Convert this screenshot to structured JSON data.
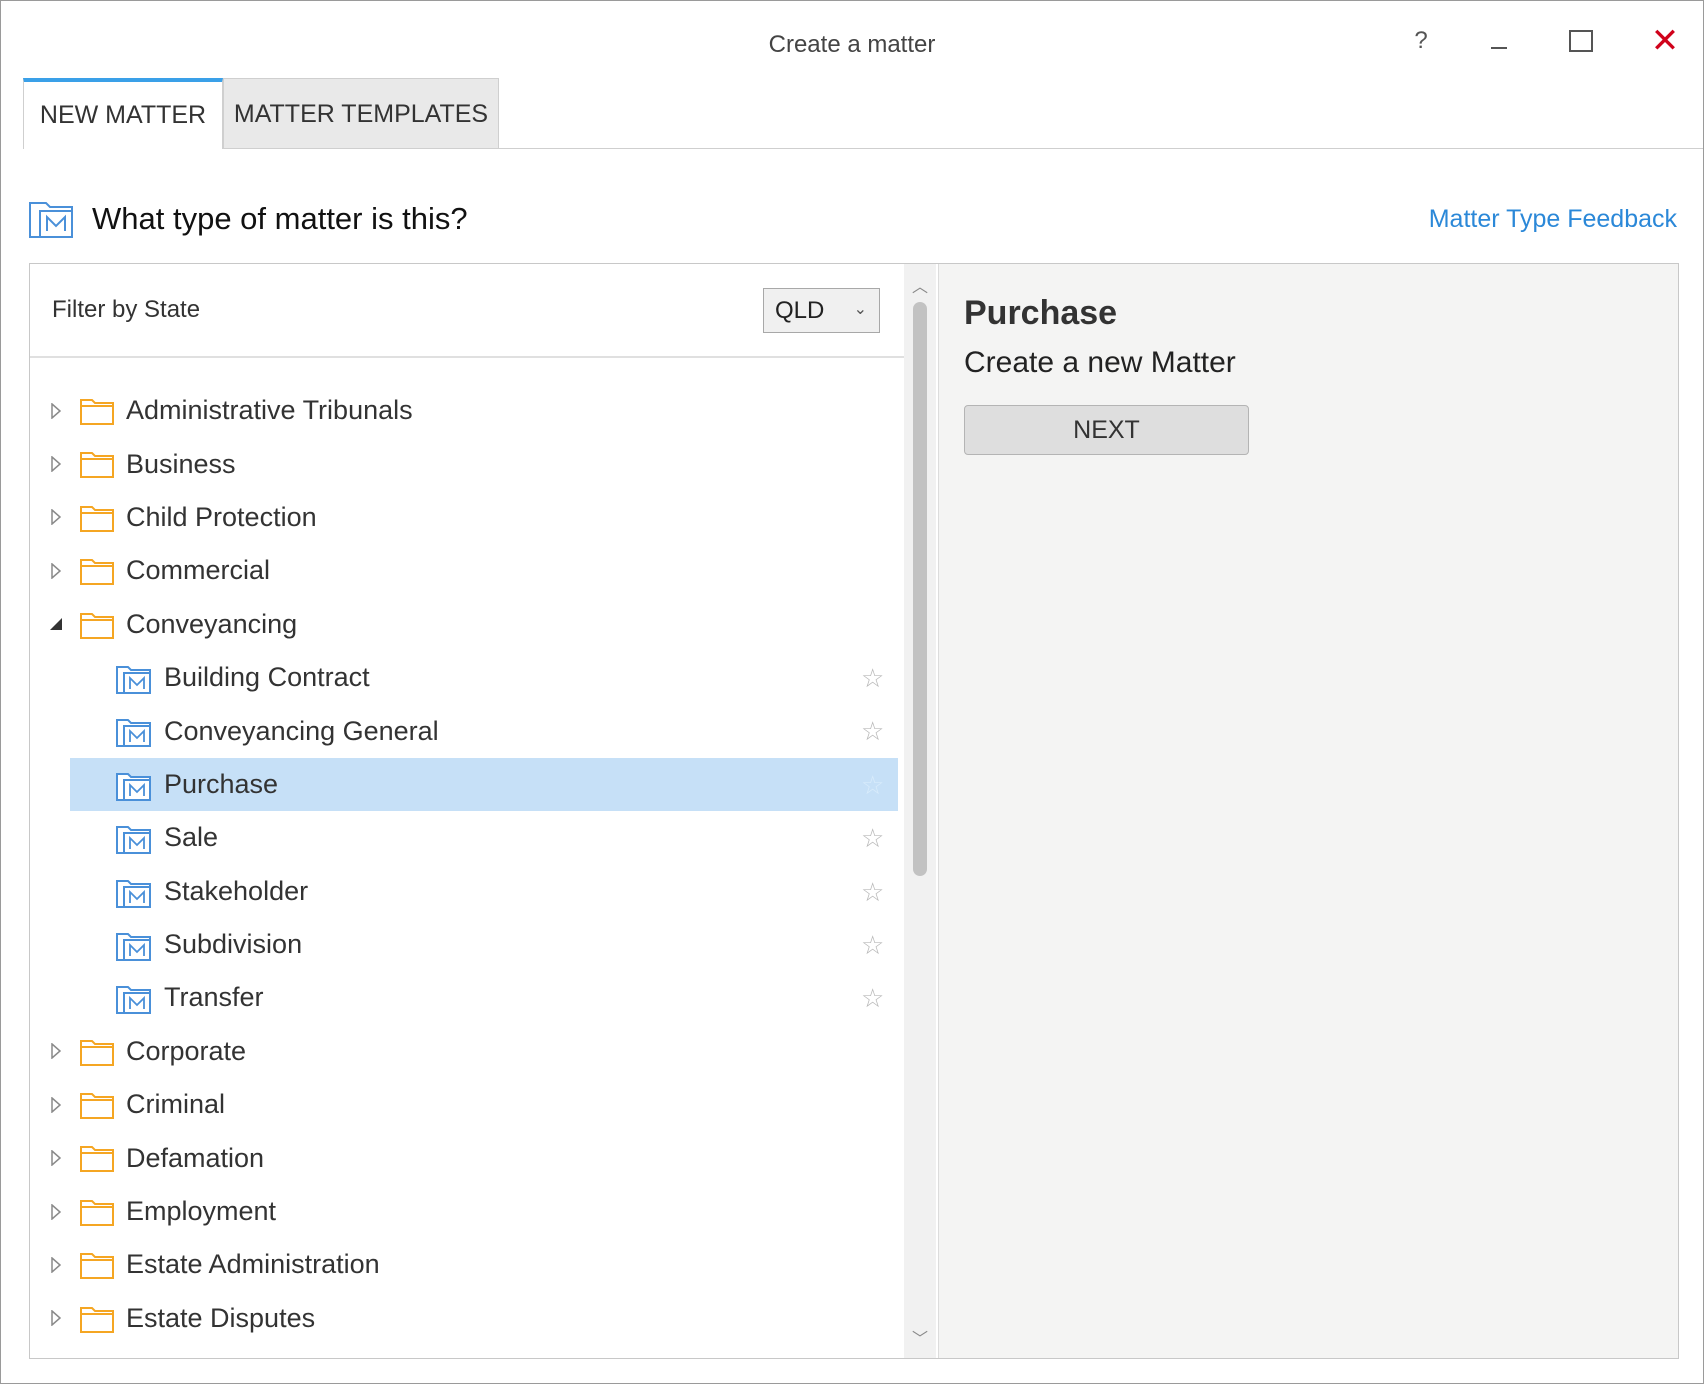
{
  "window": {
    "title": "Create a matter",
    "help_label": "?",
    "close_label": "✕"
  },
  "tabs": [
    {
      "label": "NEW MATTER",
      "active": true
    },
    {
      "label": "MATTER TEMPLATES",
      "active": false
    }
  ],
  "header": {
    "question": "What type of matter is this?",
    "feedback_link": "Matter Type Feedback"
  },
  "filter": {
    "label": "Filter by State",
    "state_value": "QLD"
  },
  "tree": {
    "top_items": [
      "Administrative Tribunals",
      "Business",
      "Child Protection",
      "Commercial",
      "Conveyancing",
      "Corporate",
      "Criminal",
      "Defamation",
      "Employment",
      "Estate Administration",
      "Estate Disputes"
    ],
    "expanded_item": "Conveyancing",
    "conveyancing_children": [
      "Building Contract",
      "Conveyancing General",
      "Purchase",
      "Sale",
      "Stakeholder",
      "Subdivision",
      "Transfer"
    ],
    "selected_child": "Purchase"
  },
  "detail": {
    "title": "Purchase",
    "subtitle": "Create a new Matter",
    "next_label": "NEXT"
  },
  "colors": {
    "accent": "#3aa0e8",
    "link": "#2b88d8",
    "selection": "#c6e0f7",
    "folder": "#f5a623",
    "matter_icon": "#4a90d9",
    "close": "#d0021b"
  }
}
